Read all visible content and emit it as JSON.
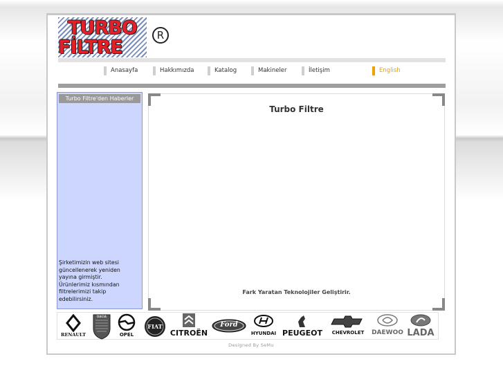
{
  "logo": {
    "line1": "TURBO",
    "line2": "FİLTRE",
    "registered": "R"
  },
  "nav": {
    "items": [
      {
        "label": "Anasayfa"
      },
      {
        "label": "Hakkımızda"
      },
      {
        "label": "Katalog"
      },
      {
        "label": "Makineler"
      },
      {
        "label": "İletişim"
      },
      {
        "label": "English"
      }
    ]
  },
  "sidebar": {
    "title": "Turbo Filtre'den Haberler",
    "news": "Şirketimizin web sitesi güncellenerek yeniden yayına girmiştir. Ürünlerimiz kısmından filtrelerimizi takip edebilirsiniz."
  },
  "content": {
    "title": "Turbo Filtre",
    "slogan": "Fark Yaratan Teknolojiler Geliştirir."
  },
  "brands": [
    "RENAULT",
    "DACIA",
    "OPEL",
    "FIAT",
    "CITROËN",
    "Ford",
    "HYUNDAI",
    "PEUGEOT",
    "CHEVROLET",
    "DAEWOO",
    "LADA"
  ],
  "footer": {
    "text": "Designed By SeMu"
  },
  "colors": {
    "accent_red": "#e2202a",
    "english_orange": "#f0a000",
    "sidebar_bg": "#cdd6ff"
  }
}
